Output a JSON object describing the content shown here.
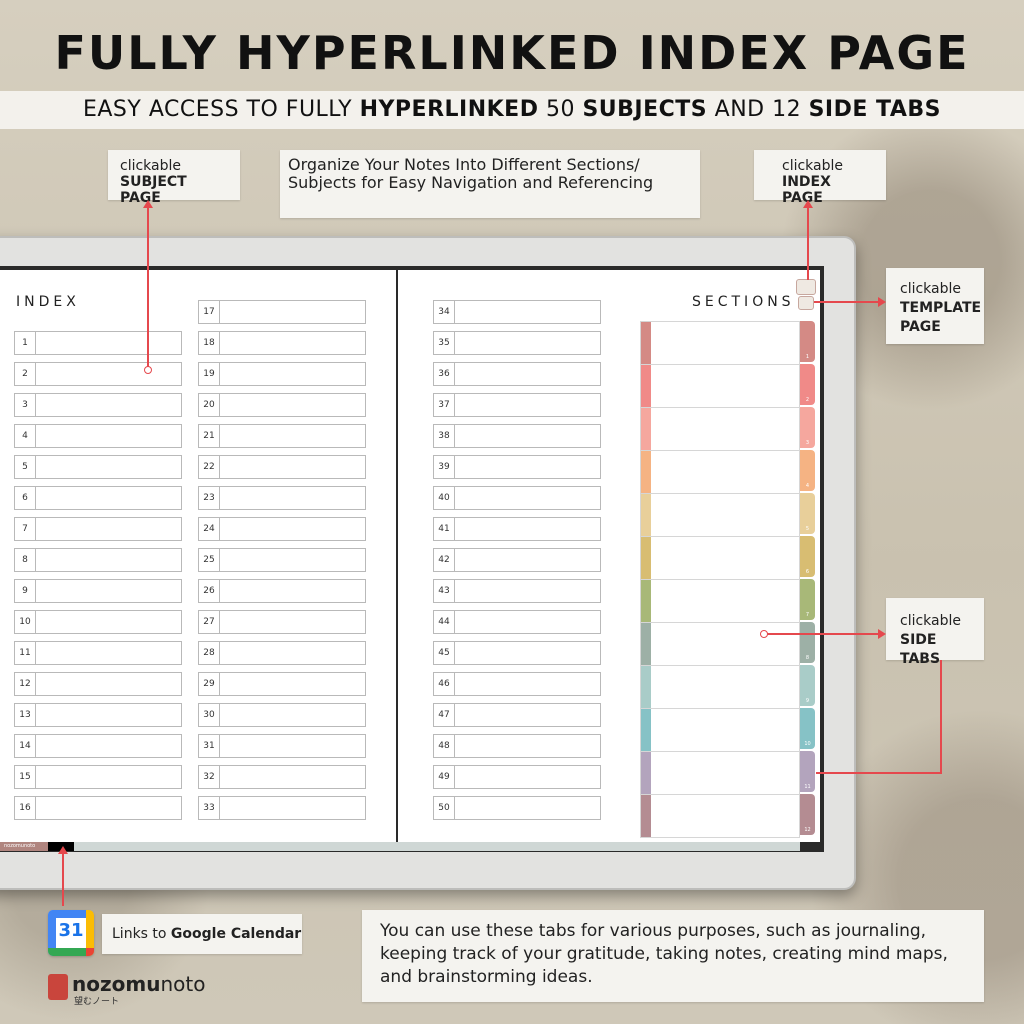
{
  "header": {
    "title": "FULLY HYPERLINKED INDEX PAGE",
    "subtitle_parts": [
      "EASY ACCESS TO FULLY ",
      "HYPERLINKED",
      " 50 ",
      "SUBJECTS",
      " AND 12 ",
      "SIDE TABS"
    ]
  },
  "callouts": {
    "subject": {
      "small": "clickable",
      "bold": "SUBJECT PAGE"
    },
    "organize": "Organize Your Notes Into Different Sections/ Subjects for Easy Navigation and Referencing",
    "index": {
      "small": "clickable",
      "bold": "INDEX PAGE"
    },
    "template": {
      "small": "clickable",
      "bold": "TEMPLATE PAGE"
    },
    "side_tabs": {
      "small": "clickable",
      "bold": "SIDE TABS"
    },
    "gcal_prefix": "Links to ",
    "gcal_bold": "Google Calendar",
    "purposes": "You can use these tabs for various purposes, such as journaling, keeping track of your gratitude, taking notes, creating mind maps, and brainstorming ideas."
  },
  "planner": {
    "index_heading": "INDEX",
    "sections_heading": "SECTIONS",
    "index_numbers": [
      "1",
      "2",
      "3",
      "4",
      "5",
      "6",
      "7",
      "8",
      "9",
      "10",
      "11",
      "12",
      "13",
      "14",
      "15",
      "16",
      "17",
      "18",
      "19",
      "20",
      "21",
      "22",
      "23",
      "24",
      "25",
      "26",
      "27",
      "28",
      "29",
      "30",
      "31",
      "32",
      "33",
      "34",
      "35",
      "36",
      "37",
      "38",
      "39",
      "40",
      "41",
      "42",
      "43",
      "44",
      "45",
      "46",
      "47",
      "48",
      "49",
      "50"
    ],
    "section_colors": [
      "#d48a85",
      "#f08a88",
      "#f5a79e",
      "#f5b383",
      "#e8cf9a",
      "#d8bd72",
      "#a8b878",
      "#9db0a6",
      "#a9ccc8",
      "#86c2c6",
      "#b3a4bd",
      "#b48c92"
    ],
    "tab_labels": [
      "1",
      "2",
      "3",
      "4",
      "5",
      "6",
      "7",
      "8",
      "9",
      "10",
      "11",
      "12"
    ],
    "bottom_logo": "nozomunoto"
  },
  "gcal_day": "31",
  "brand": {
    "name_bold": "nozomu",
    "name": "noto",
    "sub": "望むノート"
  }
}
